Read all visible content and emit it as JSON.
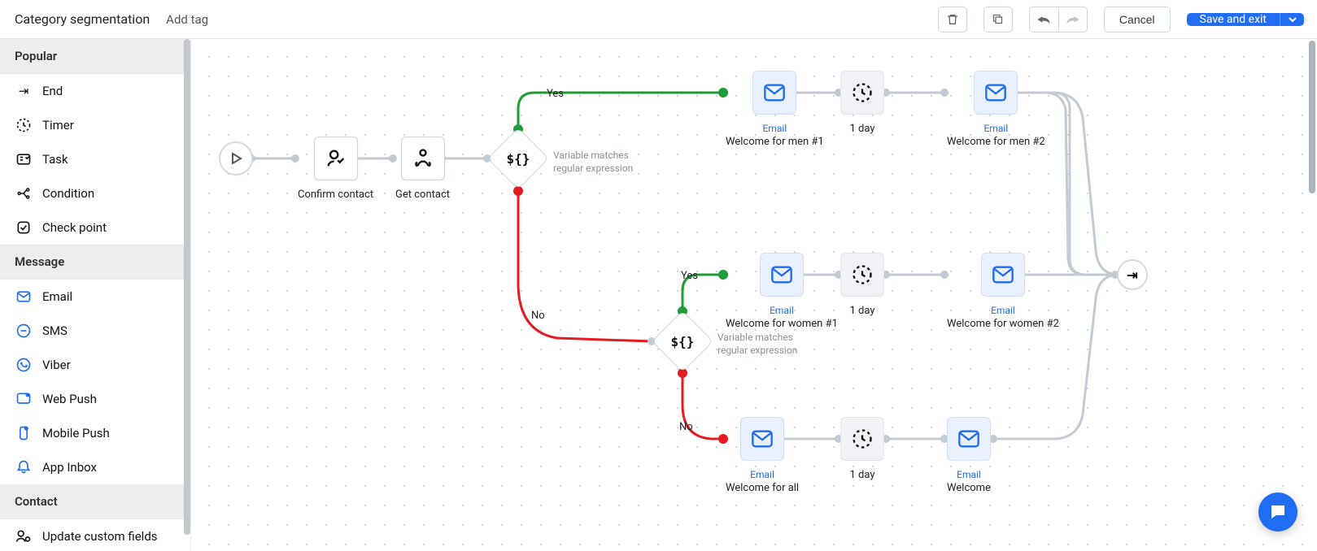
{
  "header": {
    "title": "Category segmentation",
    "add_tag": "Add tag",
    "cancel": "Cancel",
    "save": "Save and exit"
  },
  "sidebar": {
    "sections": {
      "popular": "Popular",
      "message": "Message",
      "contact": "Contact"
    },
    "popular_items": [
      {
        "label": "End"
      },
      {
        "label": "Timer"
      },
      {
        "label": "Task"
      },
      {
        "label": "Condition"
      },
      {
        "label": "Check point"
      }
    ],
    "message_items": [
      {
        "label": "Email"
      },
      {
        "label": "SMS"
      },
      {
        "label": "Viber"
      },
      {
        "label": "Web Push"
      },
      {
        "label": "Mobile Push"
      },
      {
        "label": "App Inbox"
      }
    ],
    "contact_items": [
      {
        "label": "Update custom fields"
      }
    ]
  },
  "canvas": {
    "start_action": "Confirm contact",
    "get_contact": "Get contact",
    "condition1_desc": "Variable matches regular expression",
    "condition2_desc": "Variable matches regular expression",
    "labels": {
      "yes": "Yes",
      "no": "No"
    },
    "email_type": "Email",
    "timer_label": "1 day",
    "row1": {
      "email1": "Welcome for men #1",
      "email2": "Welcome for men #2"
    },
    "row2": {
      "email1": "Welcome for women #1",
      "email2": "Welcome for women #2"
    },
    "row3": {
      "email1": "Welcome for all",
      "email2": "Welcome"
    }
  }
}
